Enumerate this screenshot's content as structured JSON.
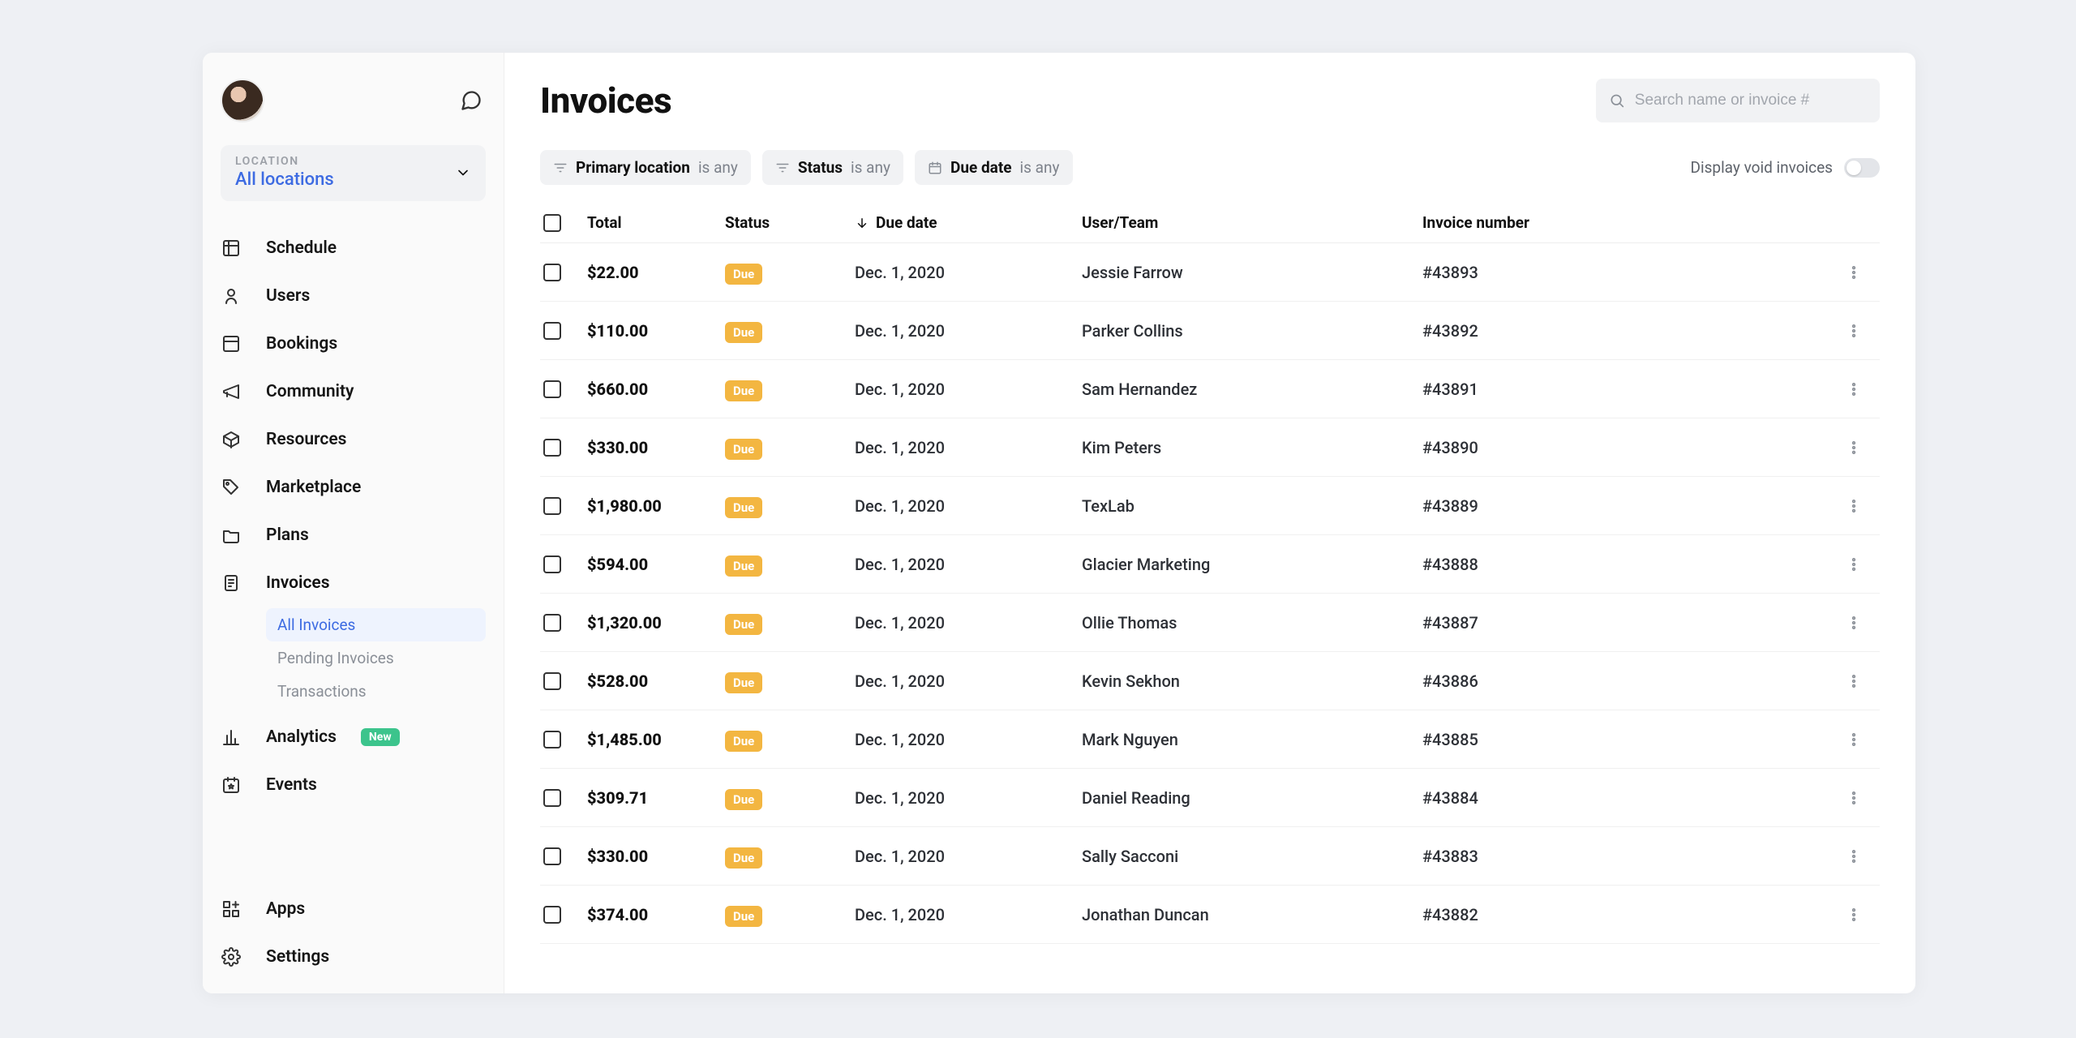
{
  "page_title": "Invoices",
  "search": {
    "placeholder": "Search name or invoice #"
  },
  "location": {
    "label": "LOCATION",
    "value": "All locations"
  },
  "nav": {
    "schedule": "Schedule",
    "users": "Users",
    "bookings": "Bookings",
    "community": "Community",
    "resources": "Resources",
    "marketplace": "Marketplace",
    "plans": "Plans",
    "invoices": "Invoices",
    "analytics": "Analytics",
    "analytics_badge": "New",
    "events": "Events",
    "apps": "Apps",
    "settings": "Settings"
  },
  "invoices_sub": {
    "all": "All Invoices",
    "pending": "Pending Invoices",
    "transactions": "Transactions"
  },
  "filters": {
    "primary_location": {
      "label": "Primary location",
      "suffix": "is any"
    },
    "status": {
      "label": "Status",
      "suffix": "is any"
    },
    "due_date": {
      "label": "Due date",
      "suffix": "is any"
    }
  },
  "void_toggle": {
    "label": "Display void invoices"
  },
  "columns": {
    "total": "Total",
    "status": "Status",
    "due": "Due date",
    "user": "User/Team",
    "invnum": "Invoice number"
  },
  "status_label": "Due",
  "rows": [
    {
      "total": "$22.00",
      "due": "Dec. 1, 2020",
      "user": "Jessie Farrow",
      "inv": "#43893"
    },
    {
      "total": "$110.00",
      "due": "Dec. 1, 2020",
      "user": "Parker Collins",
      "inv": "#43892"
    },
    {
      "total": "$660.00",
      "due": "Dec. 1, 2020",
      "user": "Sam Hernandez",
      "inv": "#43891"
    },
    {
      "total": "$330.00",
      "due": "Dec. 1, 2020",
      "user": "Kim Peters",
      "inv": "#43890"
    },
    {
      "total": "$1,980.00",
      "due": "Dec. 1, 2020",
      "user": "TexLab",
      "inv": "#43889"
    },
    {
      "total": "$594.00",
      "due": "Dec. 1, 2020",
      "user": "Glacier Marketing",
      "inv": "#43888"
    },
    {
      "total": "$1,320.00",
      "due": "Dec. 1, 2020",
      "user": "Ollie Thomas",
      "inv": "#43887"
    },
    {
      "total": "$528.00",
      "due": "Dec. 1, 2020",
      "user": "Kevin Sekhon",
      "inv": "#43886"
    },
    {
      "total": "$1,485.00",
      "due": "Dec. 1, 2020",
      "user": "Mark Nguyen",
      "inv": "#43885"
    },
    {
      "total": "$309.71",
      "due": "Dec. 1, 2020",
      "user": "Daniel Reading",
      "inv": "#43884"
    },
    {
      "total": "$330.00",
      "due": "Dec. 1, 2020",
      "user": "Sally Sacconi",
      "inv": "#43883"
    },
    {
      "total": "$374.00",
      "due": "Dec. 1, 2020",
      "user": "Jonathan Duncan",
      "inv": "#43882"
    }
  ]
}
